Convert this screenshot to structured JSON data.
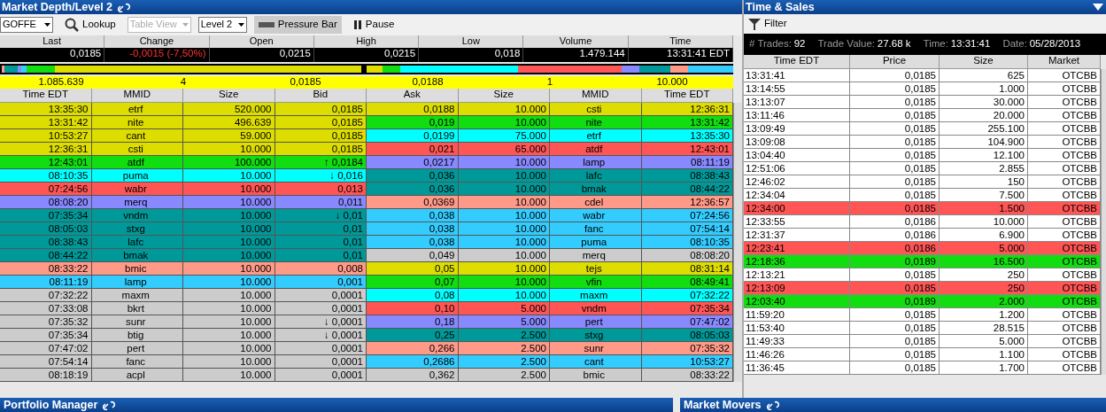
{
  "market_depth": {
    "title": "Market Depth/Level 2",
    "toolbar": {
      "symbol": "GOFFE",
      "lookup": "Lookup",
      "table_view": {
        "label": "Table View",
        "disabled": true
      },
      "level": "Level 2",
      "pressure_bar": {
        "label": "Pressure Bar",
        "selected": true
      },
      "pause": "Pause"
    },
    "quote": {
      "columns": [
        "Last",
        "Change",
        "Open",
        "High",
        "Low",
        "Volume",
        "Time"
      ],
      "values": [
        {
          "text": "0,0185",
          "kind": "plain"
        },
        {
          "text": "-0,0015 (-7,50%)",
          "kind": "down"
        },
        {
          "text": "0,0215",
          "kind": "plain"
        },
        {
          "text": "0,0215",
          "kind": "plain"
        },
        {
          "text": "0,018",
          "kind": "plain"
        },
        {
          "text": "1.479.144",
          "kind": "plain"
        },
        {
          "text": "13:31:41 EDT",
          "kind": "plain"
        }
      ]
    },
    "summary": {
      "bid": [
        "1.085.639",
        "4",
        "0,0185"
      ],
      "ask": [
        "0,0188",
        "1",
        "10.000"
      ]
    },
    "columns": [
      "Time EDT",
      "MMID",
      "Size",
      "Bid",
      "Ask",
      "Size",
      "MMID",
      "Time EDT"
    ],
    "rows": [
      {
        "bid": {
          "cells": [
            "13:35:30",
            "etrf",
            "520.000",
            "0,0185"
          ],
          "color": "#dddd00"
        },
        "ask": {
          "cells": [
            "0,0188",
            "10.000",
            "csti",
            "12:36:31"
          ],
          "color": "#dddd00"
        }
      },
      {
        "bid": {
          "cells": [
            "13:31:42",
            "nite",
            "496.639",
            "0,0185"
          ],
          "color": "#dddd00"
        },
        "ask": {
          "cells": [
            "0,019",
            "10.000",
            "nite",
            "13:31:42"
          ],
          "color": "#11dd11"
        }
      },
      {
        "bid": {
          "cells": [
            "10:53:27",
            "cant",
            "59.000",
            "0,0185"
          ],
          "color": "#dddd00"
        },
        "ask": {
          "cells": [
            "0,0199",
            "75.000",
            "etrf",
            "13:35:30"
          ],
          "color": "#00ffff"
        }
      },
      {
        "bid": {
          "cells": [
            "12:36:31",
            "csti",
            "10.000",
            "0,0185"
          ],
          "color": "#dddd00"
        },
        "ask": {
          "cells": [
            "0,021",
            "65.000",
            "atdf",
            "12:43:01"
          ],
          "color": "#ff5555"
        }
      },
      {
        "bid": {
          "cells": [
            "12:43:01",
            "atdf",
            "100.000",
            "↑ 0,0184"
          ],
          "color": "#11dd11"
        },
        "ask": {
          "cells": [
            "0,0217",
            "10.000",
            "lamp",
            "08:11:19"
          ],
          "color": "#8888ff"
        }
      },
      {
        "bid": {
          "cells": [
            "08:10:35",
            "puma",
            "10.000",
            "↓ 0,016"
          ],
          "color": "#00ffff"
        },
        "ask": {
          "cells": [
            "0,036",
            "10.000",
            "lafc",
            "08:38:43"
          ],
          "color": "#009999"
        }
      },
      {
        "bid": {
          "cells": [
            "07:24:56",
            "wabr",
            "10.000",
            "0,013"
          ],
          "color": "#ff5555"
        },
        "ask": {
          "cells": [
            "0,036",
            "10.000",
            "bmak",
            "08:44:22"
          ],
          "color": "#009999"
        }
      },
      {
        "bid": {
          "cells": [
            "08:08:20",
            "merq",
            "10.000",
            "0,011"
          ],
          "color": "#8888ff"
        },
        "ask": {
          "cells": [
            "0,0369",
            "10.000",
            "cdel",
            "12:36:57"
          ],
          "color": "#ff9988"
        }
      },
      {
        "bid": {
          "cells": [
            "07:35:34",
            "vndm",
            "10.000",
            "↓ 0,01"
          ],
          "color": "#009999"
        },
        "ask": {
          "cells": [
            "0,038",
            "10.000",
            "wabr",
            "07:24:56"
          ],
          "color": "#33ccff"
        }
      },
      {
        "bid": {
          "cells": [
            "08:05:03",
            "stxg",
            "10.000",
            "0,01"
          ],
          "color": "#009999"
        },
        "ask": {
          "cells": [
            "0,038",
            "10.000",
            "fanc",
            "07:54:14"
          ],
          "color": "#33ccff"
        }
      },
      {
        "bid": {
          "cells": [
            "08:38:43",
            "lafc",
            "10.000",
            "0,01"
          ],
          "color": "#009999"
        },
        "ask": {
          "cells": [
            "0,038",
            "10.000",
            "puma",
            "08:10:35"
          ],
          "color": "#33ccff"
        }
      },
      {
        "bid": {
          "cells": [
            "08:44:22",
            "bmak",
            "10.000",
            "0,01"
          ],
          "color": "#009999"
        },
        "ask": {
          "cells": [
            "0,049",
            "10.000",
            "merq",
            "08:08:20"
          ],
          "color": "#cccccc"
        }
      },
      {
        "bid": {
          "cells": [
            "08:33:22",
            "bmic",
            "10.000",
            "0,008"
          ],
          "color": "#ff9988"
        },
        "ask": {
          "cells": [
            "0,05",
            "10.000",
            "tejs",
            "08:31:14"
          ],
          "color": "#dddd00"
        }
      },
      {
        "bid": {
          "cells": [
            "08:11:19",
            "lamp",
            "10.000",
            "0,001"
          ],
          "color": "#33ccff"
        },
        "ask": {
          "cells": [
            "0,07",
            "10.000",
            "vfin",
            "08:49:41"
          ],
          "color": "#11dd11"
        }
      },
      {
        "bid": {
          "cells": [
            "07:32:22",
            "maxm",
            "10.000",
            "0,0001"
          ],
          "color": "#cccccc"
        },
        "ask": {
          "cells": [
            "0,08",
            "10.000",
            "maxm",
            "07:32:22"
          ],
          "color": "#00ffff"
        }
      },
      {
        "bid": {
          "cells": [
            "07:33:08",
            "bkrt",
            "10.000",
            "0,0001"
          ],
          "color": "#cccccc"
        },
        "ask": {
          "cells": [
            "0,10",
            "5.000",
            "vndm",
            "07:35:34"
          ],
          "color": "#ff5555"
        }
      },
      {
        "bid": {
          "cells": [
            "07:35:32",
            "sunr",
            "10.000",
            "↓ 0,0001"
          ],
          "color": "#cccccc"
        },
        "ask": {
          "cells": [
            "0,18",
            "5.000",
            "pert",
            "07:47:02"
          ],
          "color": "#8888ff"
        }
      },
      {
        "bid": {
          "cells": [
            "07:35:34",
            "btig",
            "10.000",
            "↓ 0,0001"
          ],
          "color": "#cccccc"
        },
        "ask": {
          "cells": [
            "0,25",
            "2.500",
            "stxg",
            "08:05:03"
          ],
          "color": "#009999"
        }
      },
      {
        "bid": {
          "cells": [
            "07:47:02",
            "pert",
            "10.000",
            "0,0001"
          ],
          "color": "#cccccc"
        },
        "ask": {
          "cells": [
            "0,266",
            "2.500",
            "sunr",
            "07:35:32"
          ],
          "color": "#ff9988"
        }
      },
      {
        "bid": {
          "cells": [
            "07:54:14",
            "fanc",
            "10.000",
            "0,0001"
          ],
          "color": "#cccccc"
        },
        "ask": {
          "cells": [
            "0,2686",
            "2.500",
            "cant",
            "10:53:27"
          ],
          "color": "#33ccff"
        }
      },
      {
        "bid": {
          "cells": [
            "08:18:19",
            "acpl",
            "10.000",
            "0,0001"
          ],
          "color": "#cccccc"
        },
        "ask": {
          "cells": [
            "0,362",
            "2.500",
            "bmic",
            "08:33:22"
          ],
          "color": "#cccccc"
        }
      }
    ]
  },
  "time_and_sales": {
    "title": "Time & Sales",
    "filter": "Filter",
    "stats": [
      {
        "label": "# Trades:",
        "value": "92"
      },
      {
        "label": "Trade Value:",
        "value": "27.68 k"
      },
      {
        "label": "Time:",
        "value": "13:31:41"
      },
      {
        "label": "Date:",
        "value": "05/28/2013"
      }
    ],
    "columns": [
      "Time EDT",
      "Price",
      "Size",
      "Market"
    ],
    "rows": [
      {
        "cells": [
          "13:31:41",
          "0,0185",
          "625",
          "OTCBB"
        ],
        "color": "#ffffff"
      },
      {
        "cells": [
          "13:14:55",
          "0,0185",
          "1.000",
          "OTCBB"
        ],
        "color": "#ffffff"
      },
      {
        "cells": [
          "13:13:07",
          "0,0185",
          "30.000",
          "OTCBB"
        ],
        "color": "#ffffff"
      },
      {
        "cells": [
          "13:11:46",
          "0,0185",
          "20.000",
          "OTCBB"
        ],
        "color": "#ffffff"
      },
      {
        "cells": [
          "13:09:49",
          "0,0185",
          "255.100",
          "OTCBB"
        ],
        "color": "#ffffff"
      },
      {
        "cells": [
          "13:09:08",
          "0,0185",
          "104.900",
          "OTCBB"
        ],
        "color": "#ffffff"
      },
      {
        "cells": [
          "13:04:40",
          "0,0185",
          "12.100",
          "OTCBB"
        ],
        "color": "#ffffff"
      },
      {
        "cells": [
          "12:51:06",
          "0,0185",
          "2.855",
          "OTCBB"
        ],
        "color": "#ffffff"
      },
      {
        "cells": [
          "12:46:02",
          "0,0185",
          "150",
          "OTCBB"
        ],
        "color": "#ffffff"
      },
      {
        "cells": [
          "12:34:04",
          "0,0185",
          "7.500",
          "OTCBB"
        ],
        "color": "#ffffff"
      },
      {
        "cells": [
          "12:34:00",
          "0,0185",
          "1.500",
          "OTCBB"
        ],
        "color": "#ff5555"
      },
      {
        "cells": [
          "12:33:55",
          "0,0186",
          "10.000",
          "OTCBB"
        ],
        "color": "#ffffff"
      },
      {
        "cells": [
          "12:31:37",
          "0,0186",
          "6.900",
          "OTCBB"
        ],
        "color": "#ffffff"
      },
      {
        "cells": [
          "12:23:41",
          "0,0186",
          "5.000",
          "OTCBB"
        ],
        "color": "#ff5555"
      },
      {
        "cells": [
          "12:18:36",
          "0,0189",
          "16.500",
          "OTCBB"
        ],
        "color": "#11dd11"
      },
      {
        "cells": [
          "12:13:21",
          "0,0185",
          "250",
          "OTCBB"
        ],
        "color": "#ffffff"
      },
      {
        "cells": [
          "12:13:09",
          "0,0185",
          "250",
          "OTCBB"
        ],
        "color": "#ff5555"
      },
      {
        "cells": [
          "12:03:40",
          "0,0189",
          "2.000",
          "OTCBB"
        ],
        "color": "#11dd11"
      },
      {
        "cells": [
          "11:59:20",
          "0,0185",
          "1.200",
          "OTCBB"
        ],
        "color": "#ffffff"
      },
      {
        "cells": [
          "11:53:40",
          "0,0185",
          "28.515",
          "OTCBB"
        ],
        "color": "#ffffff"
      },
      {
        "cells": [
          "11:49:33",
          "0,0185",
          "5.000",
          "OTCBB"
        ],
        "color": "#ffffff"
      },
      {
        "cells": [
          "11:46:26",
          "0,0185",
          "1.100",
          "OTCBB"
        ],
        "color": "#ffffff"
      },
      {
        "cells": [
          "11:36:45",
          "0,0185",
          "1.700",
          "OTCBB"
        ],
        "color": "#ffffff"
      }
    ]
  },
  "bottom_panels": [
    "Portfolio Manager",
    "Market Movers"
  ]
}
